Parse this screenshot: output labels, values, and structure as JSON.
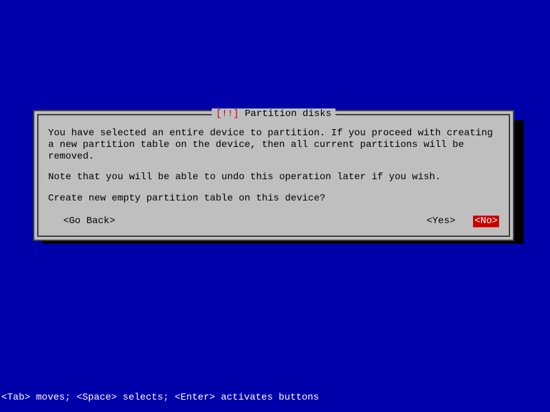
{
  "dialog": {
    "title_bang": "[!!]",
    "title_text": "Partition disks",
    "paragraph1": "You have selected an entire device to partition. If you proceed with creating a new partition table on the device, then all current partitions will be removed.",
    "paragraph2": "Note that you will be able to undo this operation later if you wish.",
    "question": "Create new empty partition table on this device?",
    "goback": "<Go Back>",
    "yes": "<Yes>",
    "no": "<No>"
  },
  "statusbar": "<Tab> moves; <Space> selects; <Enter> activates buttons"
}
